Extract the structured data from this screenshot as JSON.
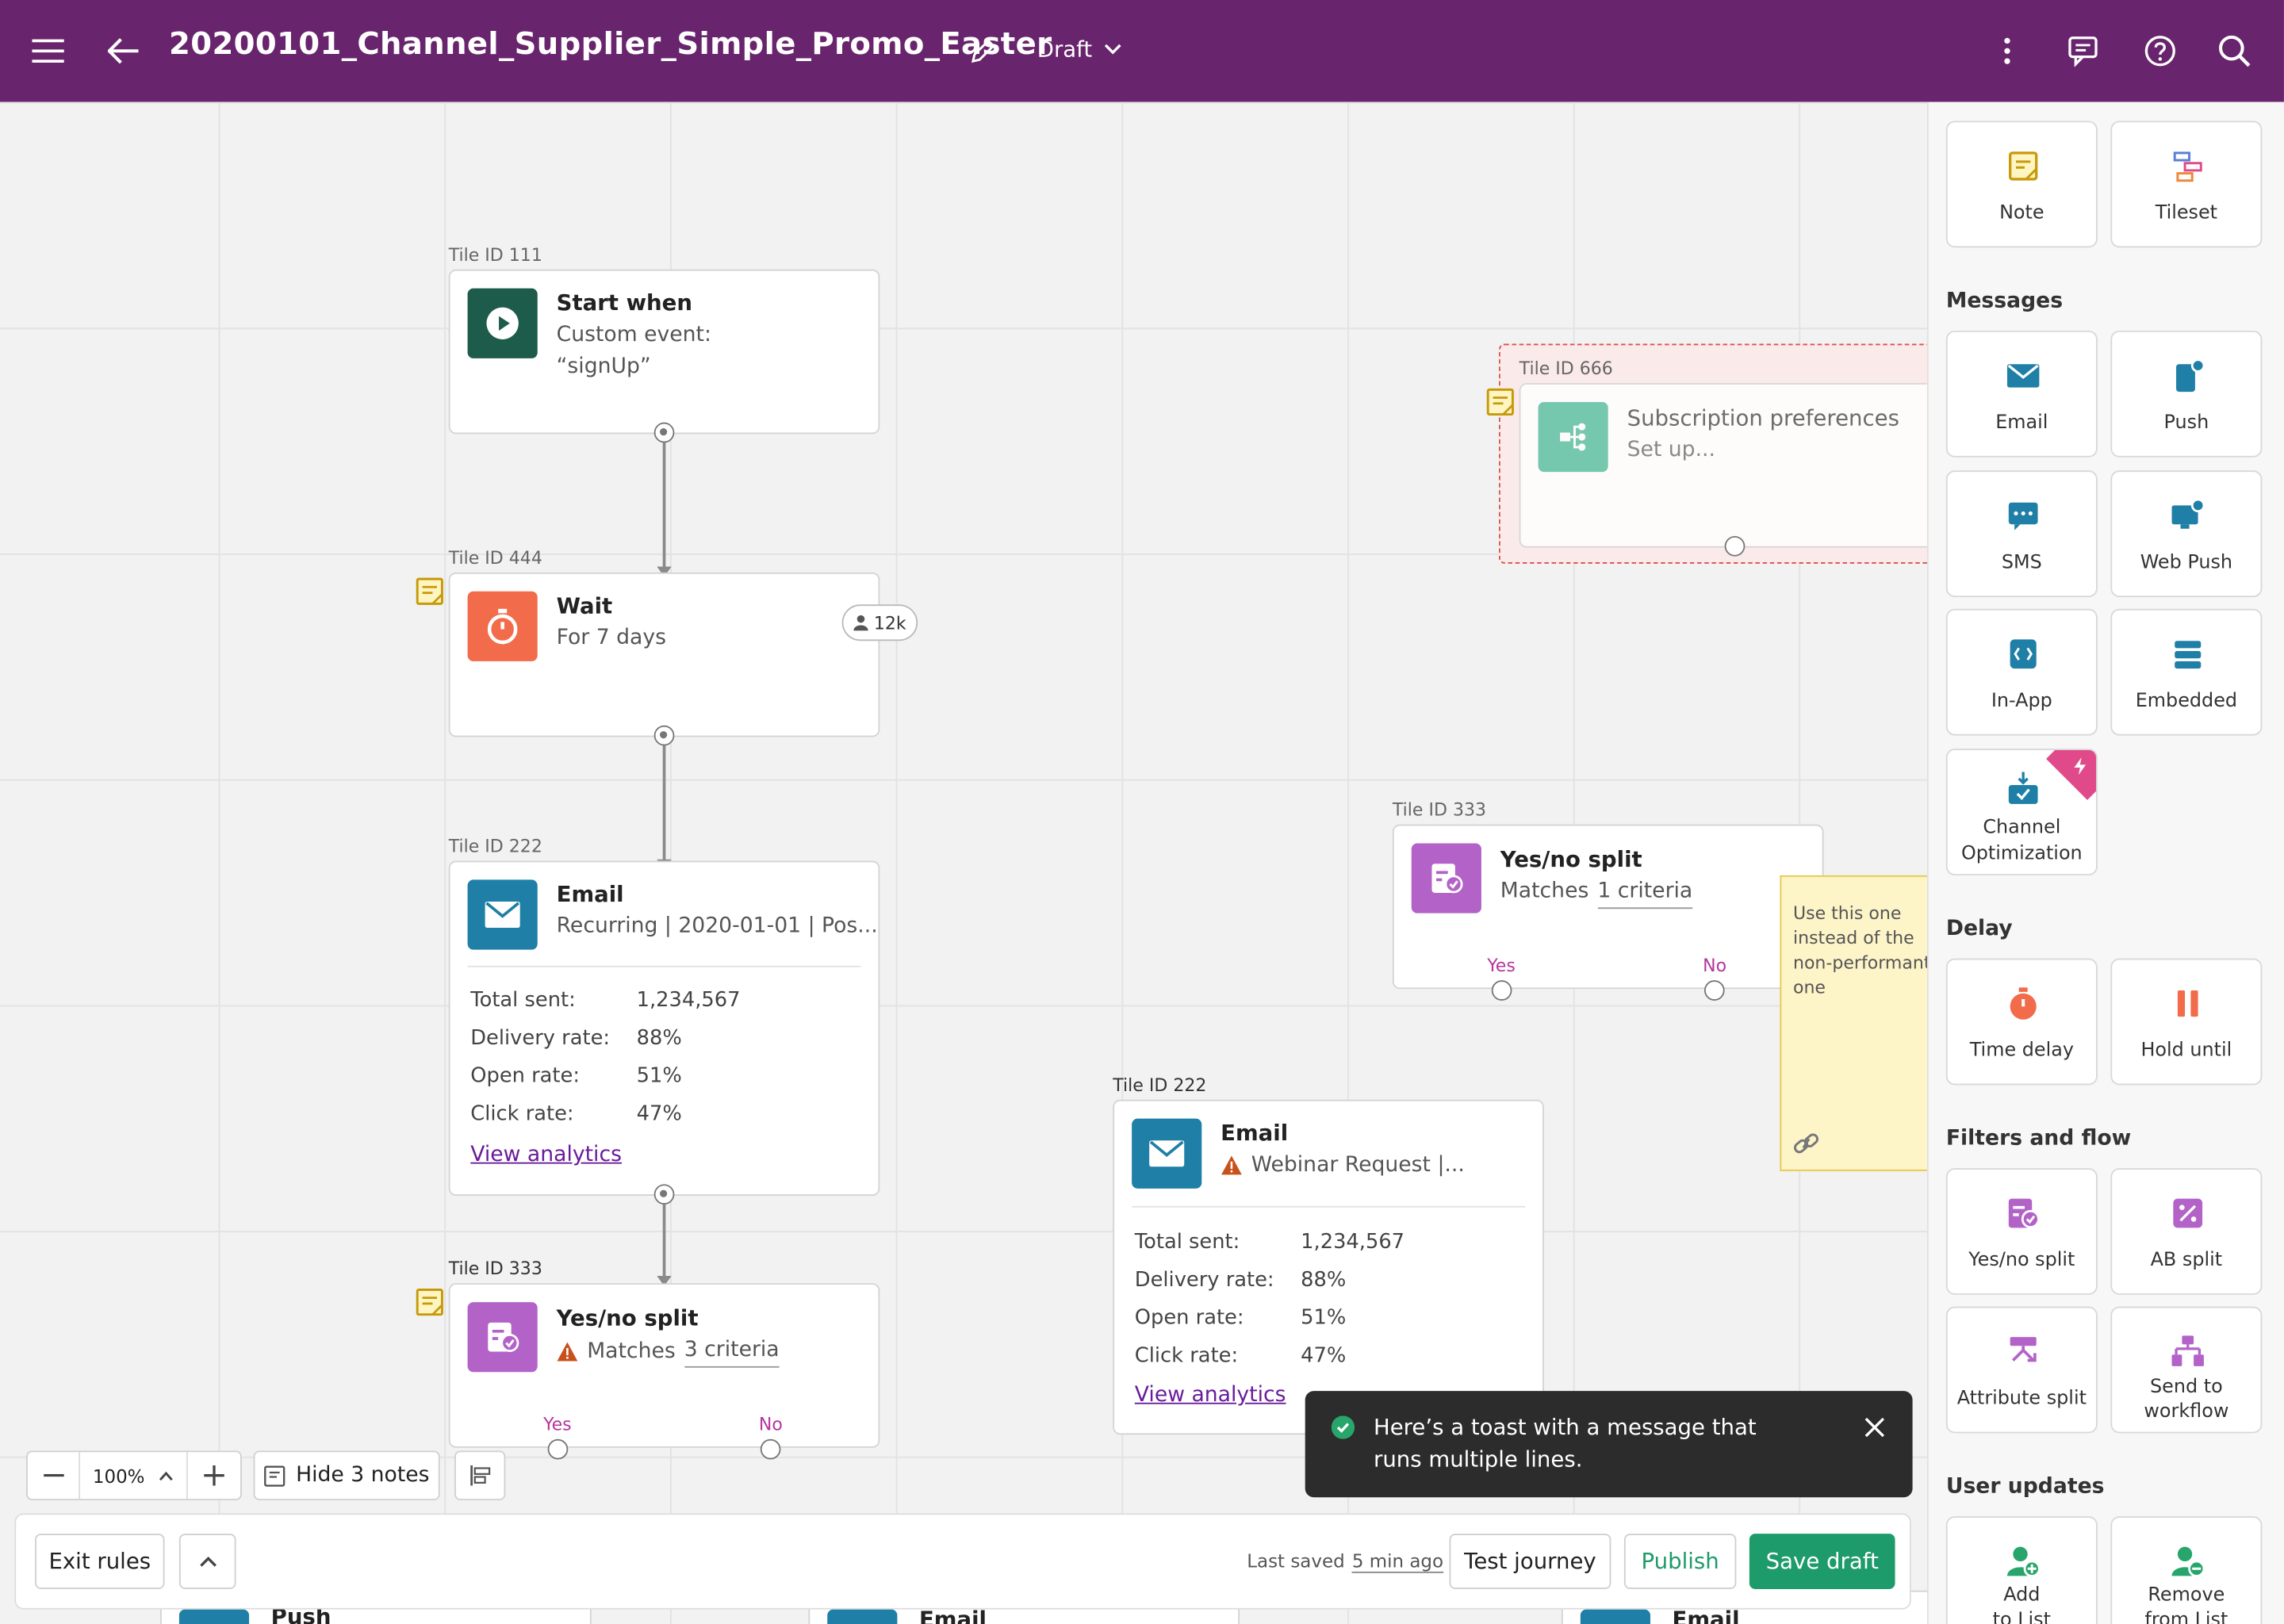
{
  "header": {
    "title": "20200101_Channel_Supplier_Simple_Promo_Easter",
    "status": "Draft"
  },
  "tiles": {
    "start": {
      "id_label": "Tile ID 111",
      "title": "Start when",
      "line1": "Custom event:",
      "line2": "“signUp”"
    },
    "wait": {
      "id_label": "Tile ID 444",
      "title": "Wait",
      "sub": "For 7 days",
      "badge": "12k"
    },
    "email1": {
      "id_label": "Tile ID 222",
      "title": "Email",
      "sub": "Recurring | 2020-01-01 | Pos...",
      "stats": [
        {
          "label": "Total sent:",
          "value": "1,234,567"
        },
        {
          "label": "Delivery rate:",
          "value": "88%"
        },
        {
          "label": "Open rate:",
          "value": "51%"
        },
        {
          "label": "Click rate:",
          "value": "47%"
        }
      ],
      "link": "View analytics"
    },
    "split1": {
      "id_label": "Tile ID 333",
      "title": "Yes/no split",
      "sub_pre": "Matches",
      "sub_link": "3 criteria",
      "yes": "Yes",
      "no": "No"
    },
    "subs": {
      "id_label": "Tile ID 666",
      "title": "Subscription preferences",
      "sub": "Set up..."
    },
    "split2": {
      "id_label": "Tile ID 333",
      "title": "Yes/no split",
      "sub_pre": "Matches",
      "sub_link": "1 criteria",
      "yes": "Yes",
      "no": "No"
    },
    "email2": {
      "id_label": "Tile ID 222",
      "title": "Email",
      "sub": "Webinar Request |...",
      "stats": [
        {
          "label": "Total sent:",
          "value": "1,234,567"
        },
        {
          "label": "Delivery rate:",
          "value": "88%"
        },
        {
          "label": "Open rate:",
          "value": "51%"
        },
        {
          "label": "Click rate:",
          "value": "47%"
        }
      ],
      "link": "View analytics"
    }
  },
  "sticky_note": {
    "text": "Use this one instead of the non-performant one"
  },
  "bottom_tiles": {
    "push": "Push",
    "email_a": "Email",
    "email_b": "Email"
  },
  "zoom": {
    "value": "100%",
    "hide_notes": "Hide 3 notes"
  },
  "toast": {
    "message": "Here’s a toast with a message that runs multiple lines."
  },
  "footer": {
    "exit": "Exit rules",
    "last_saved_prefix": "Last saved",
    "last_saved_time": "5 min ago",
    "test": "Test journey",
    "publish": "Publish",
    "save": "Save draft"
  },
  "sidebar": {
    "top": [
      {
        "label": "Note"
      },
      {
        "label": "Tileset"
      }
    ],
    "messages_title": "Messages",
    "messages": [
      {
        "label": "Email"
      },
      {
        "label": "Push"
      },
      {
        "label": "SMS"
      },
      {
        "label": "Web Push"
      },
      {
        "label": "In-App"
      },
      {
        "label": "Embedded"
      },
      {
        "label1": "Channel",
        "label2": "Optimization"
      }
    ],
    "delay_title": "Delay",
    "delay": [
      {
        "label": "Time delay"
      },
      {
        "label": "Hold until"
      }
    ],
    "filters_title": "Filters and flow",
    "filters": [
      {
        "label": "Yes/no split"
      },
      {
        "label": "AB split"
      },
      {
        "label": "Attribute split"
      },
      {
        "label1": "Send to",
        "label2": "workflow"
      }
    ],
    "user_title": "User updates",
    "user": [
      {
        "label1": "Add",
        "label2": "to List"
      },
      {
        "label1": "Remove",
        "label2": "from List"
      }
    ]
  },
  "colors": {
    "header": "#68246d",
    "start": "#1d5b4a",
    "wait": "#f26b4a",
    "email": "#1f7fa6",
    "split": "#b363c8",
    "subs": "#5ec3a3",
    "save": "#1e9b6b",
    "link": "#6a1b9a"
  }
}
